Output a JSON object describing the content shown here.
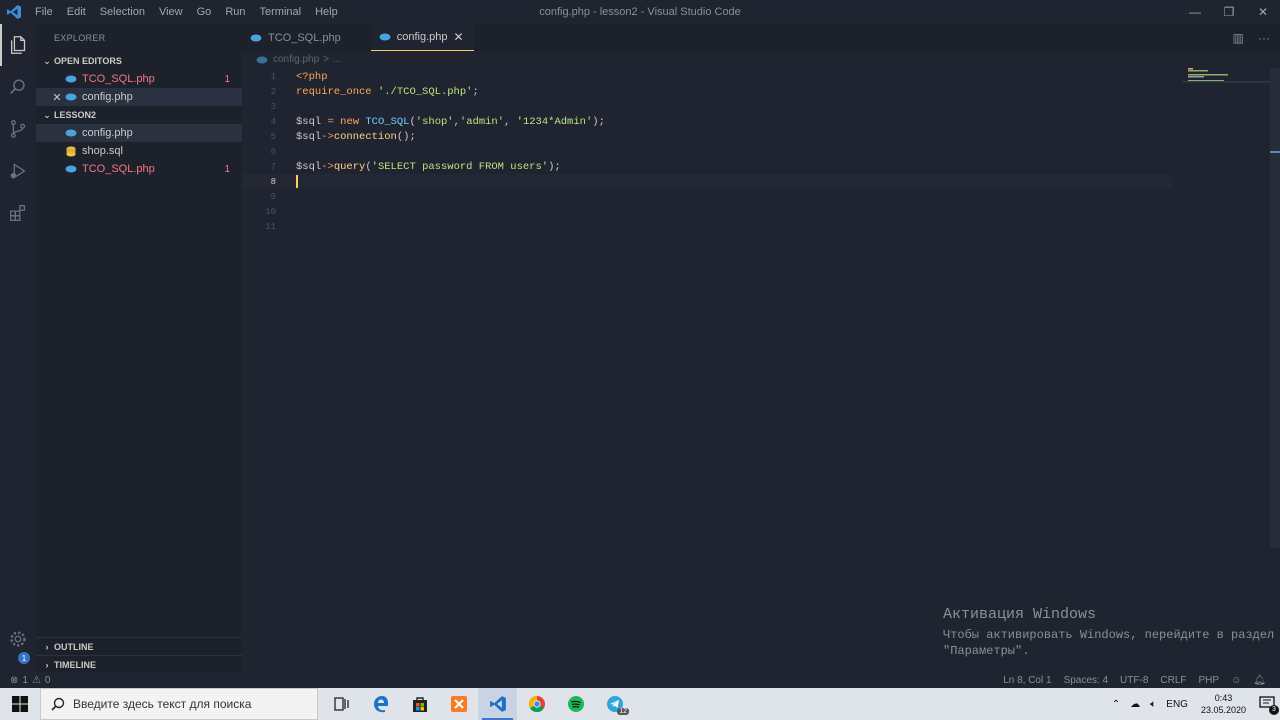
{
  "window": {
    "title": "config.php - lesson2 - Visual Studio Code",
    "menu": [
      "File",
      "Edit",
      "Selection",
      "View",
      "Go",
      "Run",
      "Terminal",
      "Help"
    ],
    "controls": {
      "minimize": "—",
      "maximize": "❐",
      "close": "✕"
    }
  },
  "sidebar": {
    "title": "EXPLORER",
    "open_editors": {
      "label": "OPEN EDITORS",
      "items": [
        {
          "name": "TCO_SQL.php",
          "count": "1"
        },
        {
          "name": "config.php",
          "close": "✕"
        }
      ]
    },
    "folder": {
      "label": "LESSON2",
      "items": [
        {
          "name": "config.php"
        },
        {
          "name": "shop.sql"
        },
        {
          "name": "TCO_SQL.php",
          "count": "1"
        }
      ]
    },
    "outline": "OUTLINE",
    "timeline": "TIMELINE"
  },
  "activity": {
    "settings_badge": "1"
  },
  "tabs": [
    {
      "label": "TCO_SQL.php"
    },
    {
      "label": "config.php",
      "close": "✕"
    }
  ],
  "tab_actions": {
    "split": "▥",
    "more": "···"
  },
  "breadcrumb": {
    "file": "config.php",
    "sep": ">",
    "rest": "..."
  },
  "editor": {
    "line_numbers": [
      "1",
      "2",
      "3",
      "4",
      "5",
      "6",
      "7",
      "8",
      "9",
      "10",
      "11"
    ],
    "lines": [
      "<?php",
      "require_once './TCO_SQL.php';",
      "",
      "$sql = new TCO_SQL('shop','admin', '1234*Admin');",
      "$sql->connection();",
      "",
      "$sql->query('SELECT password FROM users');",
      "",
      "",
      "",
      ""
    ],
    "current_line": 8
  },
  "activation": {
    "title": "Активация Windows",
    "line1": "Чтобы активировать Windows, перейдите в раздел",
    "line2": "\"Параметры\"."
  },
  "statusbar": {
    "errors": "1",
    "warnings": "0",
    "position": "Ln 8, Col 1",
    "spaces": "Spaces: 4",
    "encoding": "UTF-8",
    "eol": "CRLF",
    "language": "PHP"
  },
  "taskbar": {
    "search_placeholder": "Введите здесь текст для поиска",
    "lang": "ENG",
    "time": "0:43",
    "date": "23.05.2020",
    "notifications": "3",
    "telegram_badge": "12"
  }
}
